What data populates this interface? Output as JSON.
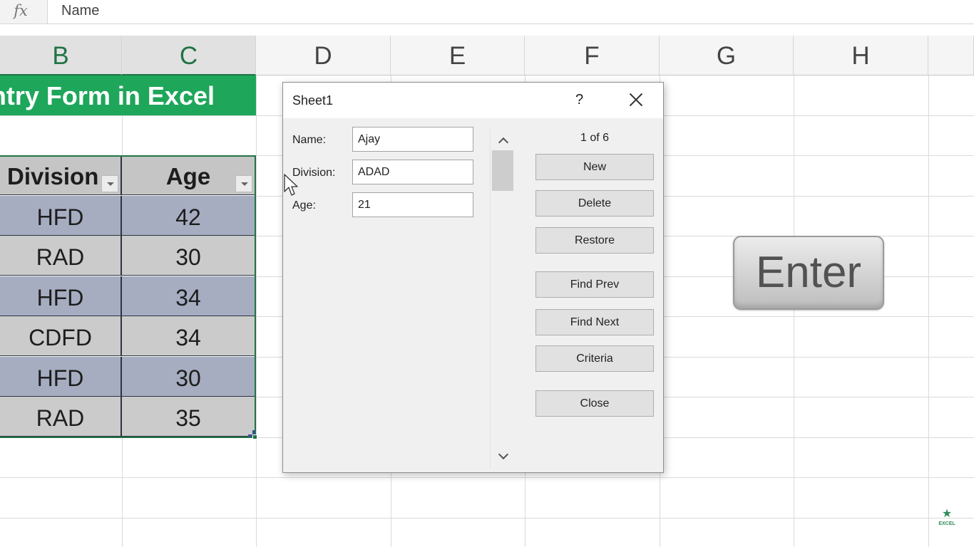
{
  "formula_bar": {
    "fx_label": "fx",
    "value": "Name"
  },
  "columns": [
    "B",
    "C",
    "D",
    "E",
    "F",
    "G",
    "H"
  ],
  "sheet_title": "ntry Form in Excel",
  "table": {
    "headers": [
      "Division",
      "Age"
    ],
    "rows": [
      [
        "HFD",
        "42"
      ],
      [
        "RAD",
        "30"
      ],
      [
        "HFD",
        "34"
      ],
      [
        "CDFD",
        "34"
      ],
      [
        "HFD",
        "30"
      ],
      [
        "RAD",
        "35"
      ]
    ]
  },
  "dialog": {
    "title": "Sheet1",
    "help": "?",
    "record_counter": "1 of 6",
    "fields": [
      {
        "label": "Name:",
        "value": "Ajay"
      },
      {
        "label": "Division:",
        "value": "ADAD"
      },
      {
        "label": "Age:",
        "value": "21"
      }
    ],
    "buttons": [
      "New",
      "Delete",
      "Restore",
      "Find Prev",
      "Find Next",
      "Criteria",
      "Close"
    ]
  },
  "enter_key_label": "Enter",
  "watermark": "EXCEL",
  "colors": {
    "accent_green": "#1ea65b",
    "excel_green": "#217346",
    "band_blue": "#a6adc1"
  }
}
